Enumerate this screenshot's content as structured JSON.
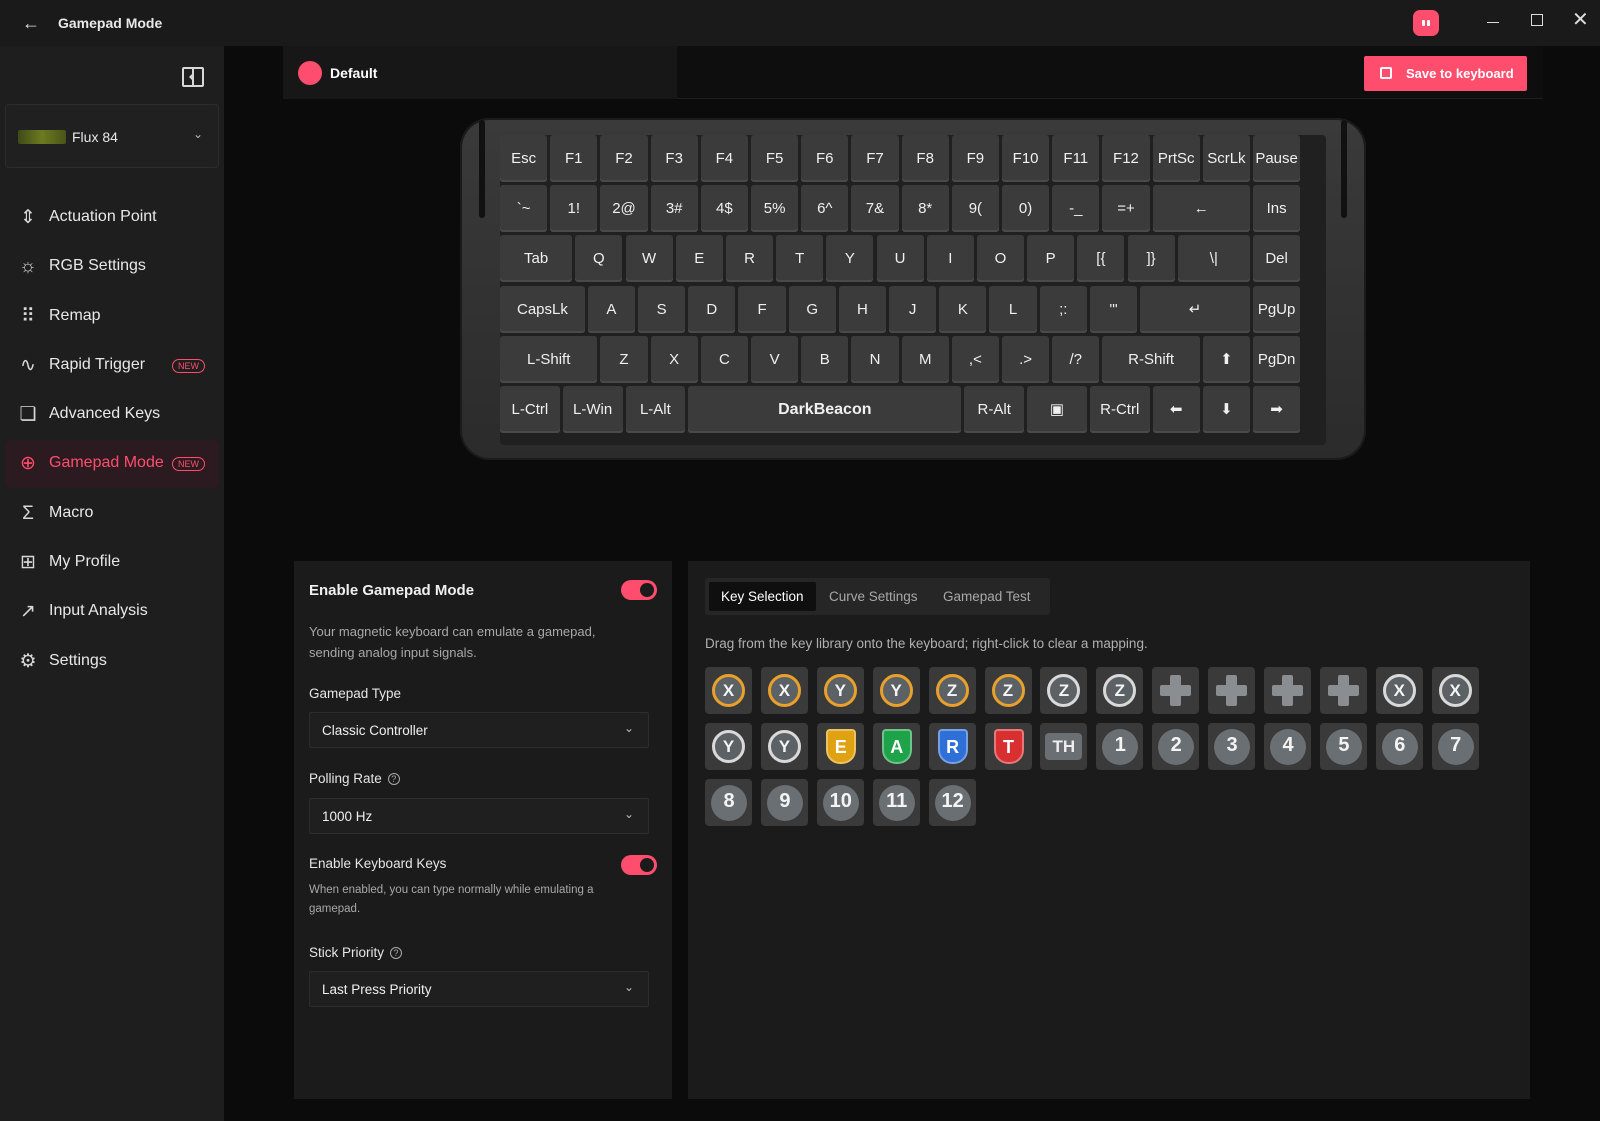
{
  "window": {
    "title": "Gamepad Mode"
  },
  "device": {
    "name": "Flux 84"
  },
  "nav": [
    {
      "label": "Actuation Point",
      "icon": "actuation-icon",
      "glyph": "⇕"
    },
    {
      "label": "RGB Settings",
      "icon": "sun-icon",
      "glyph": "☼"
    },
    {
      "label": "Remap",
      "icon": "grid-dots-icon",
      "glyph": "⠿"
    },
    {
      "label": "Rapid Trigger",
      "icon": "pulse-icon",
      "glyph": "∿",
      "badge": "NEW"
    },
    {
      "label": "Advanced Keys",
      "icon": "keys-icon",
      "glyph": "❏"
    },
    {
      "label": "Gamepad Mode",
      "icon": "gamepad-icon",
      "glyph": "⊕",
      "badge": "NEW",
      "active": true
    },
    {
      "label": "Macro",
      "icon": "sigma-icon",
      "glyph": "Σ"
    },
    {
      "label": "My Profile",
      "icon": "profile-grid-icon",
      "glyph": "⊞"
    },
    {
      "label": "Input Analysis",
      "icon": "chart-line-icon",
      "glyph": "↗"
    },
    {
      "label": "Settings",
      "icon": "gear-icon",
      "glyph": "⚙"
    }
  ],
  "profile": {
    "name": "Default",
    "color": "#ff4d6d"
  },
  "save_button": {
    "label": "Save to keyboard"
  },
  "keyboard": {
    "rows": [
      [
        "Esc",
        "F1",
        "F2",
        "F3",
        "F4",
        "F5",
        "F6",
        "F7",
        "F8",
        "F9",
        "F10",
        "F11",
        "F12",
        "PrtSc",
        "ScrLk",
        "Pause"
      ],
      [
        "`~",
        "1!",
        "2@",
        "3#",
        "4$",
        "5%",
        "6^",
        "7&",
        "8*",
        "9(",
        "0)",
        "-_",
        "=+",
        "←",
        "Ins"
      ],
      [
        "Tab",
        "Q",
        "W",
        "E",
        "R",
        "T",
        "Y",
        "U",
        "I",
        "O",
        "P",
        "[{",
        "]}",
        "\\|",
        "Del"
      ],
      [
        "CapsLk",
        "A",
        "S",
        "D",
        "F",
        "G",
        "H",
        "J",
        "K",
        "L",
        ";:",
        "'\"",
        "↵",
        "PgUp"
      ],
      [
        "L-Shift",
        "Z",
        "X",
        "C",
        "V",
        "B",
        "N",
        "M",
        ",<",
        ".>",
        "/?",
        "R-Shift",
        "⬆",
        "PgDn"
      ],
      [
        "L-Ctrl",
        "L-Win",
        "L-Alt",
        "DarkBeacon",
        "R-Alt",
        "▣",
        "R-Ctrl",
        "⬅",
        "⬇",
        "➡"
      ]
    ]
  },
  "gamepad": {
    "title": "Enable Gamepad Mode",
    "enabled": true,
    "description": "Your magnetic keyboard can emulate a gamepad, sending analog input signals.",
    "type_label": "Gamepad Type",
    "type_value": "Classic Controller",
    "polling_label": "Polling Rate",
    "polling_value": "1000 Hz",
    "keyboard_keys_label": "Enable Keyboard Keys",
    "keyboard_keys_enabled": true,
    "keyboard_keys_desc": "When enabled, you can type normally while emulating a gamepad.",
    "stick_label": "Stick Priority",
    "stick_value": "Last Press Priority"
  },
  "tabs": [
    {
      "label": "Key Selection",
      "active": true
    },
    {
      "label": "Curve Settings"
    },
    {
      "label": "Gamepad Test"
    }
  ],
  "hint": "Drag from the key library onto the keyboard; right-click to clear a mapping.",
  "library": [
    {
      "kind": "stick",
      "label": "X",
      "style": "ring-o",
      "icon": "stick-x-left-icon"
    },
    {
      "kind": "stick",
      "label": "X",
      "style": "ring-o",
      "icon": "stick-x-right-icon"
    },
    {
      "kind": "stick",
      "label": "Y",
      "style": "ring-o",
      "icon": "stick-y-up-icon"
    },
    {
      "kind": "stick",
      "label": "Y",
      "style": "ring-o",
      "icon": "stick-y-down-icon"
    },
    {
      "kind": "stick",
      "label": "Z",
      "style": "ring-o",
      "icon": "stick-z-up-icon"
    },
    {
      "kind": "stick",
      "label": "Z",
      "style": "ring-o",
      "icon": "stick-z-down-icon"
    },
    {
      "kind": "stick",
      "label": "Z",
      "style": "ring",
      "icon": "rotate-z-cw-icon"
    },
    {
      "kind": "stick",
      "label": "Z",
      "style": "ring",
      "icon": "rotate-z-ccw-icon"
    },
    {
      "kind": "dpad",
      "icon": "dpad-up-icon"
    },
    {
      "kind": "dpad",
      "icon": "dpad-down-icon"
    },
    {
      "kind": "dpad",
      "icon": "dpad-left-icon"
    },
    {
      "kind": "dpad",
      "icon": "dpad-right-icon"
    },
    {
      "kind": "stick",
      "label": "X",
      "style": "ring",
      "icon": "rotate-x-ccw-icon"
    },
    {
      "kind": "stick",
      "label": "X",
      "style": "ring",
      "icon": "rotate-x-cw-icon"
    },
    {
      "kind": "stick",
      "label": "Y",
      "style": "ring",
      "icon": "rotate-y-ccw-icon"
    },
    {
      "kind": "stick",
      "label": "Y",
      "style": "ring",
      "icon": "rotate-y-cw-icon"
    },
    {
      "kind": "shield",
      "label": "E",
      "color": "#e0a112",
      "icon": "button-e-icon"
    },
    {
      "kind": "shield",
      "label": "A",
      "color": "#1fa34a",
      "icon": "button-a-icon"
    },
    {
      "kind": "shield",
      "label": "R",
      "color": "#2f6fd8",
      "icon": "button-r-icon"
    },
    {
      "kind": "shield",
      "label": "T",
      "color": "#d83030",
      "icon": "button-t-icon"
    },
    {
      "kind": "th",
      "label": "TH",
      "icon": "button-th-icon"
    },
    {
      "kind": "num",
      "label": "1",
      "icon": "button-1-icon"
    },
    {
      "kind": "num",
      "label": "2",
      "icon": "button-2-icon"
    },
    {
      "kind": "num",
      "label": "3",
      "icon": "button-3-icon"
    },
    {
      "kind": "num",
      "label": "4",
      "icon": "button-4-icon"
    },
    {
      "kind": "num",
      "label": "5",
      "icon": "button-5-icon"
    },
    {
      "kind": "num",
      "label": "6",
      "icon": "button-6-icon"
    },
    {
      "kind": "num",
      "label": "7",
      "icon": "button-7-icon"
    },
    {
      "kind": "num",
      "label": "8",
      "icon": "button-8-icon"
    },
    {
      "kind": "num",
      "label": "9",
      "icon": "button-9-icon"
    },
    {
      "kind": "num",
      "label": "10",
      "icon": "button-10-icon"
    },
    {
      "kind": "num",
      "label": "11",
      "icon": "button-11-icon"
    },
    {
      "kind": "num",
      "label": "12",
      "icon": "button-12-icon"
    }
  ],
  "colors": {
    "accent": "#ff4d6d"
  }
}
